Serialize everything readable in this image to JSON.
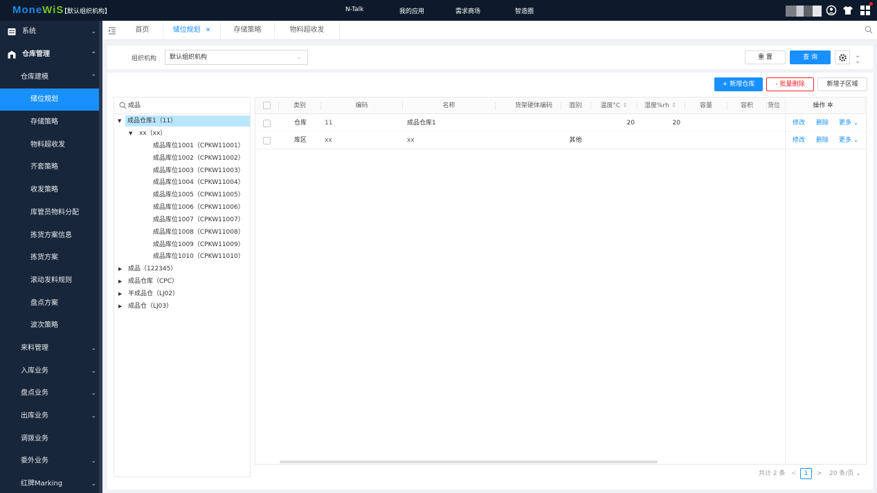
{
  "topbar": {
    "logo_a": "Mone",
    "logo_b": "WiS",
    "org": "【默认组织机构】",
    "nav": [
      "N-Talk",
      "我的应用",
      "需求商场",
      "智造圈"
    ]
  },
  "sidebar": {
    "items": [
      {
        "label": "系统",
        "chev": "⌄"
      },
      {
        "label": "仓库管理",
        "chev": "⌃"
      },
      {
        "label": "仓库建模",
        "chev": "⌃"
      },
      {
        "label": "储位规划"
      },
      {
        "label": "存储策略"
      },
      {
        "label": "物料超收发"
      },
      {
        "label": "齐套策略"
      },
      {
        "label": "收发策略"
      },
      {
        "label": "库管员物料分配"
      },
      {
        "label": "拣货方案信息"
      },
      {
        "label": "拣货方案"
      },
      {
        "label": "滚动发料规则"
      },
      {
        "label": "盘点方案"
      },
      {
        "label": "波次策略"
      },
      {
        "label": "来料管理",
        "chev": "⌄"
      },
      {
        "label": "入库业务",
        "chev": "⌄"
      },
      {
        "label": "盘点业务",
        "chev": "⌄"
      },
      {
        "label": "出库业务",
        "chev": "⌄"
      },
      {
        "label": "调拨业务"
      },
      {
        "label": "委外业务",
        "chev": "⌄"
      },
      {
        "label": "红牌Marking",
        "chev": "⌄"
      }
    ]
  },
  "tabs": [
    {
      "label": "首页"
    },
    {
      "label": "储位规划",
      "close": "✕"
    },
    {
      "label": "存储策略"
    },
    {
      "label": "物料超收发"
    }
  ],
  "filter": {
    "org_label": "组织机构",
    "org_value": "默认组织机构",
    "reset": "重 置",
    "query": "查 询"
  },
  "actions": {
    "add_warehouse": "+ 新增仓库",
    "batch_delete": "- 批量删除",
    "add_subarea": "新增子区域"
  },
  "tree": {
    "search_value": "成品",
    "nodes": [
      {
        "label": "成品仓库1（11）"
      },
      {
        "label": "xx（xx）"
      },
      {
        "label": "成品库位1001（CPKW11001）"
      },
      {
        "label": "成品库位1002（CPKW11002）"
      },
      {
        "label": "成品库位1003（CPKW11003）"
      },
      {
        "label": "成品库位1004（CPKW11004）"
      },
      {
        "label": "成品库位1005（CPKW11005）"
      },
      {
        "label": "成品库位1006（CPKW11006）"
      },
      {
        "label": "成品库位1007（CPKW11007）"
      },
      {
        "label": "成品库位1008（CPKW11008）"
      },
      {
        "label": "成品库位1009（CPKW11009）"
      },
      {
        "label": "成品库位1010（CPKW11010）"
      },
      {
        "label": "成品（122345）"
      },
      {
        "label": "成品仓库（CPC）"
      },
      {
        "label": "半成品仓（LJ02）"
      },
      {
        "label": "成品仓（LJ03）"
      }
    ]
  },
  "table": {
    "headers": [
      "类别",
      "编码",
      "名称",
      "货架硬体编码",
      "面别",
      "温度°C",
      "湿度%rh",
      "容量",
      "容积",
      "货位",
      "操作"
    ],
    "rows": [
      {
        "type": "仓库",
        "code": "11",
        "name": "成品仓库1",
        "face": "",
        "temp": "20",
        "humid": "20"
      },
      {
        "type": "库区",
        "code": "xx",
        "name": "xx",
        "face": "其他",
        "temp": "",
        "humid": ""
      }
    ],
    "ops": {
      "edit": "修改",
      "del": "删除",
      "more": "更多"
    }
  },
  "pager": {
    "total": "共计 2 条",
    "page": "1",
    "size": "20 条/页"
  }
}
